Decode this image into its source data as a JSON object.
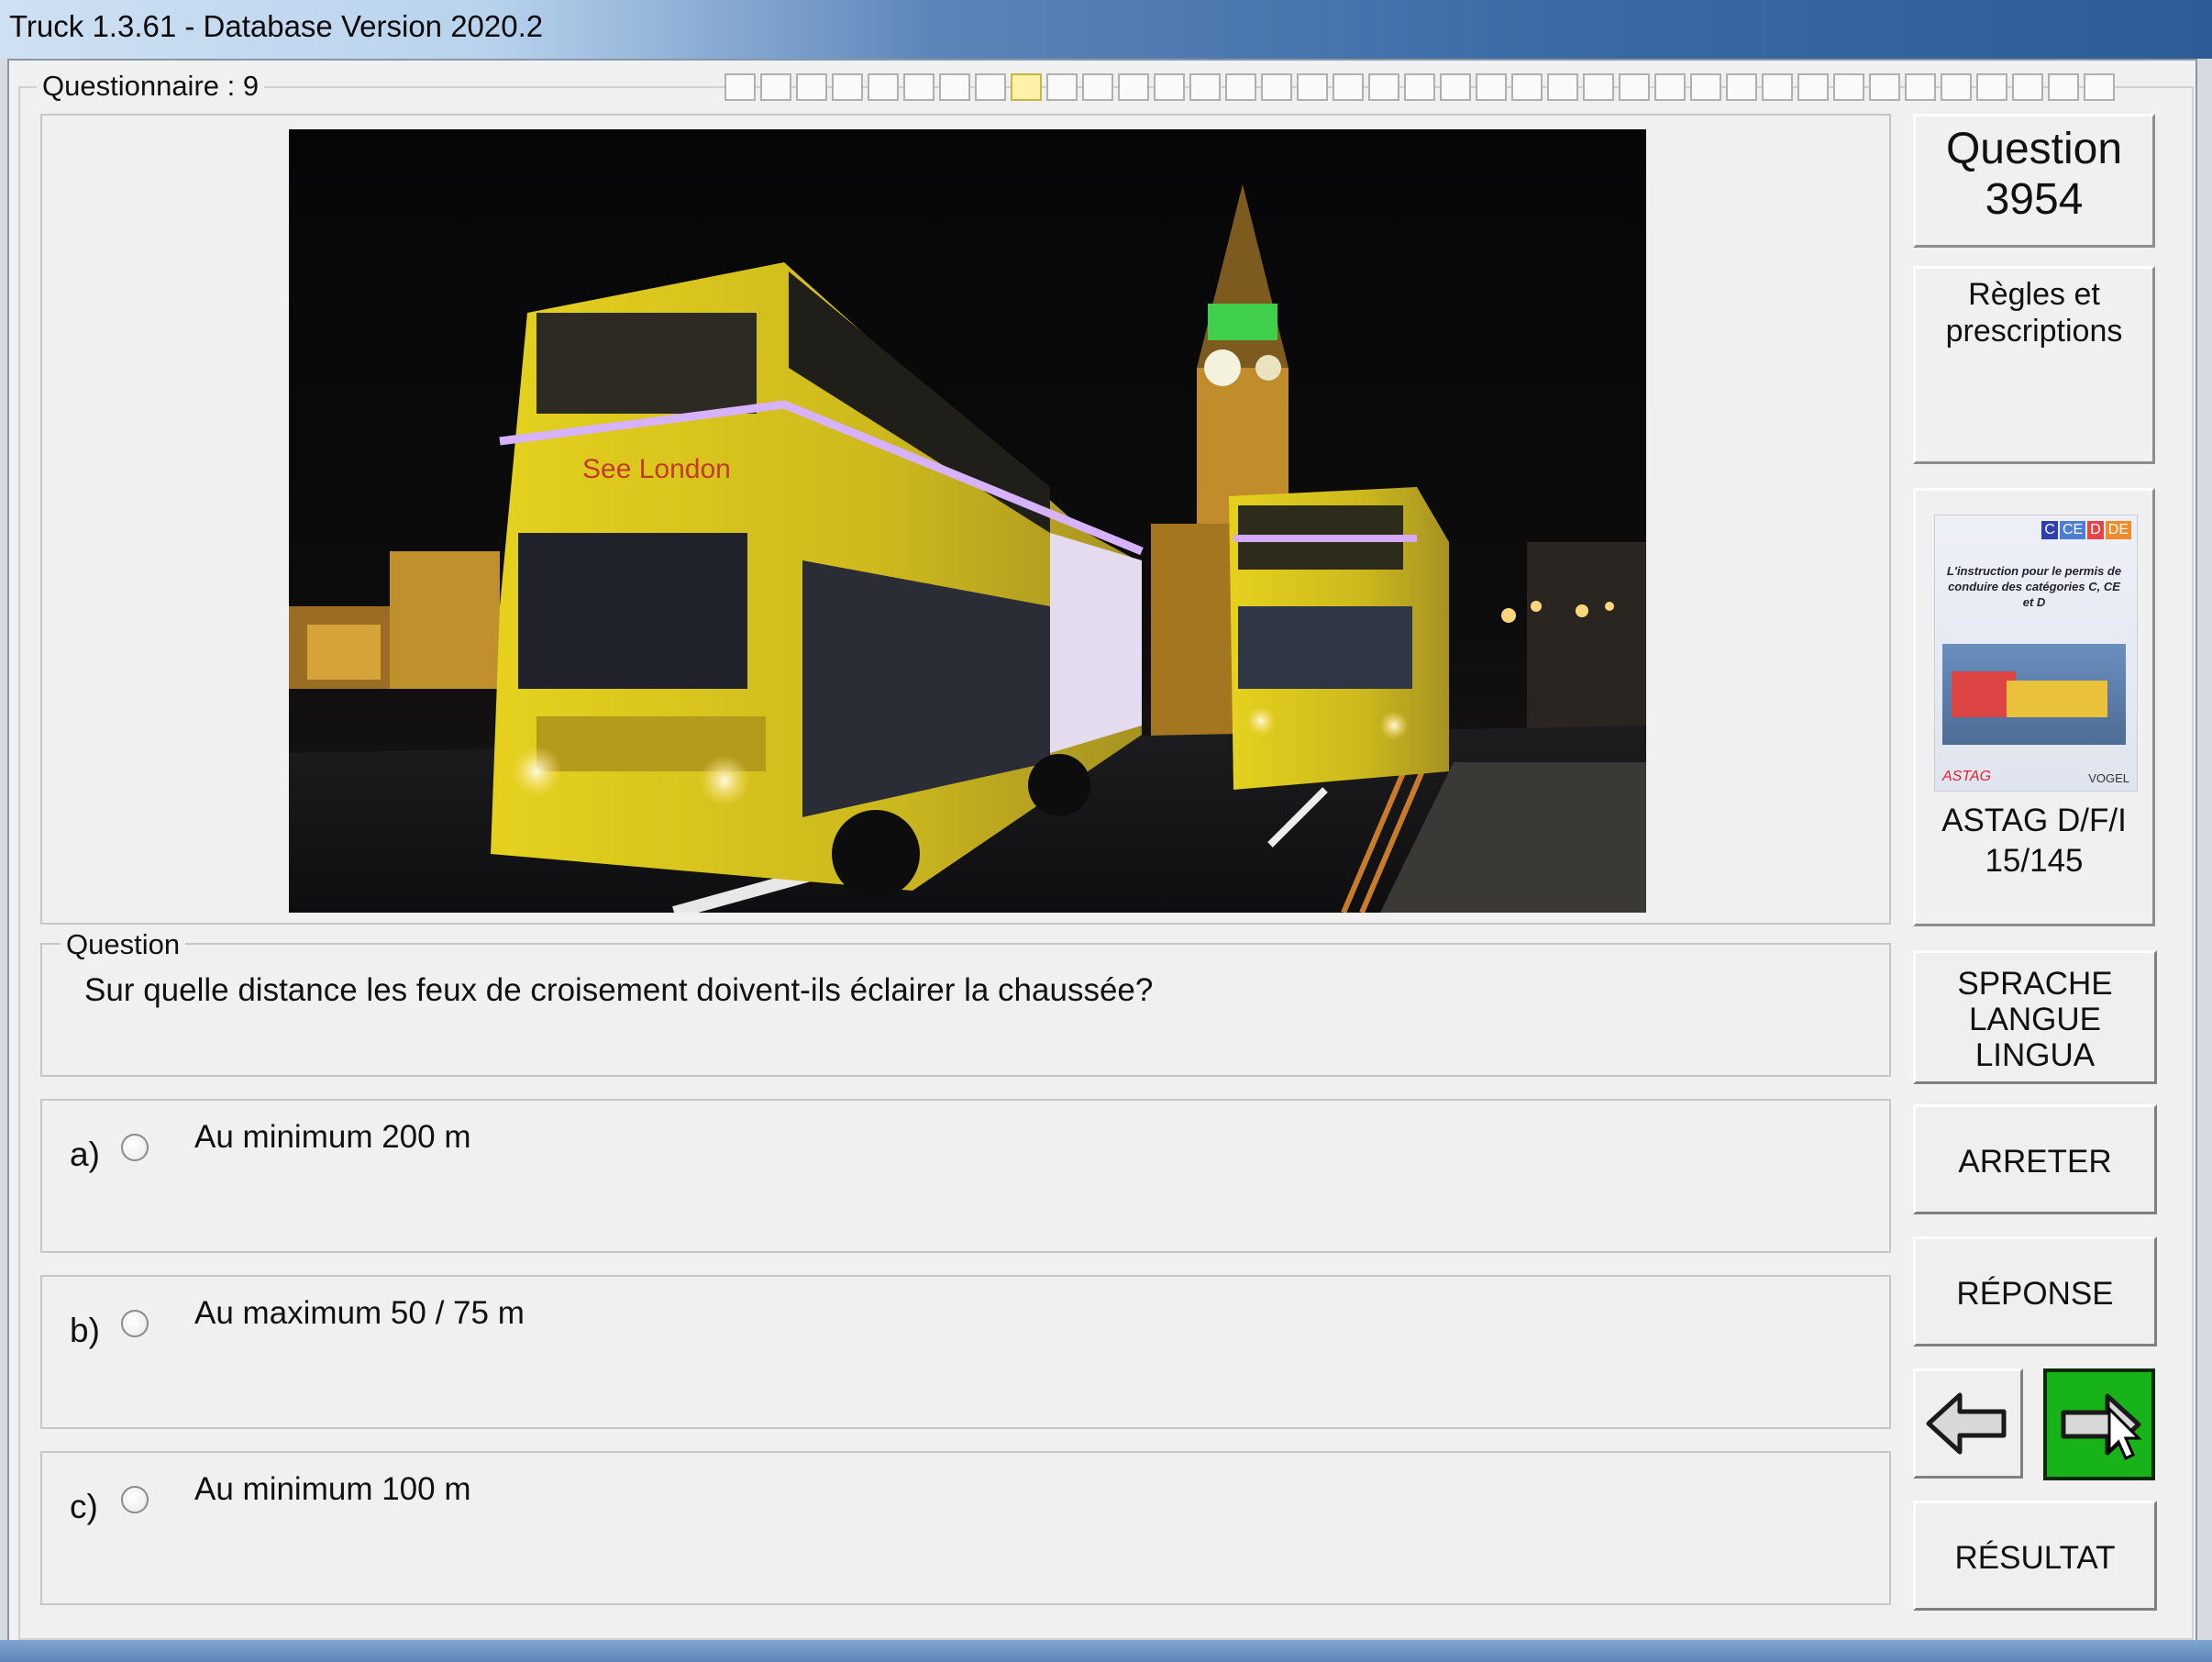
{
  "window": {
    "title": "Truck 1.3.61 - Database Version 2020.2"
  },
  "questionnaire": {
    "label": "Questionnaire : 9",
    "progress_total": 39,
    "progress_current_index": 8
  },
  "question_number": {
    "line1": "Question",
    "line2": "3954"
  },
  "category": {
    "line1": "Règles et",
    "line2": "prescriptions"
  },
  "book": {
    "cover_badges": [
      "C",
      "CE",
      "D",
      "DE"
    ],
    "cover_title": "L'instruction pour le permis de conduire des catégories C, CE et D",
    "cover_left_logo": "ASTAG",
    "cover_right_logo": "VOGEL",
    "caption_line1": "ASTAG D/F/I",
    "caption_line2": "15/145"
  },
  "buttons": {
    "language": [
      "SPRACHE",
      "LANGUE",
      "LINGUA"
    ],
    "stop": "ARRETER",
    "answer": "RÉPONSE",
    "result": "RÉSULTAT",
    "prev_icon": "arrow-left-icon",
    "next_icon": "arrow-right-icon",
    "next_color": "#18b318"
  },
  "question": {
    "legend": "Question",
    "text": "Sur quelle distance les feux de croisement doivent-ils éclairer la chaussée?"
  },
  "answers": [
    {
      "letter": "a)",
      "text": "Au minimum 200 m",
      "selected": false
    },
    {
      "letter": "b)",
      "text": "Au maximum 50 / 75 m",
      "selected": false
    },
    {
      "letter": "c)",
      "text": "Au minimum 100 m",
      "selected": false
    }
  ],
  "photo": {
    "subject": "double-decker-buses-night-london",
    "bus_text": "See London"
  }
}
